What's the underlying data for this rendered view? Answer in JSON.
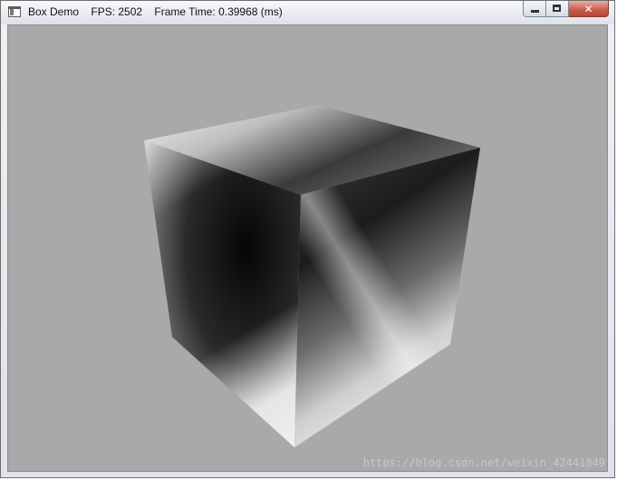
{
  "window": {
    "title": "Box Demo    FPS: 2502    Frame Time: 0.39968 (ms)",
    "icon": "app-window-icon",
    "buttons": {
      "minimize_icon": "minimize-icon",
      "maximize_icon": "maximize-icon",
      "close_icon": "close-icon",
      "close_glyph": "✕"
    }
  },
  "scene": {
    "background_color": "#a9a9a9",
    "object": "cube",
    "watermark": "https://blog.csdn.net/weixin_42441849"
  }
}
